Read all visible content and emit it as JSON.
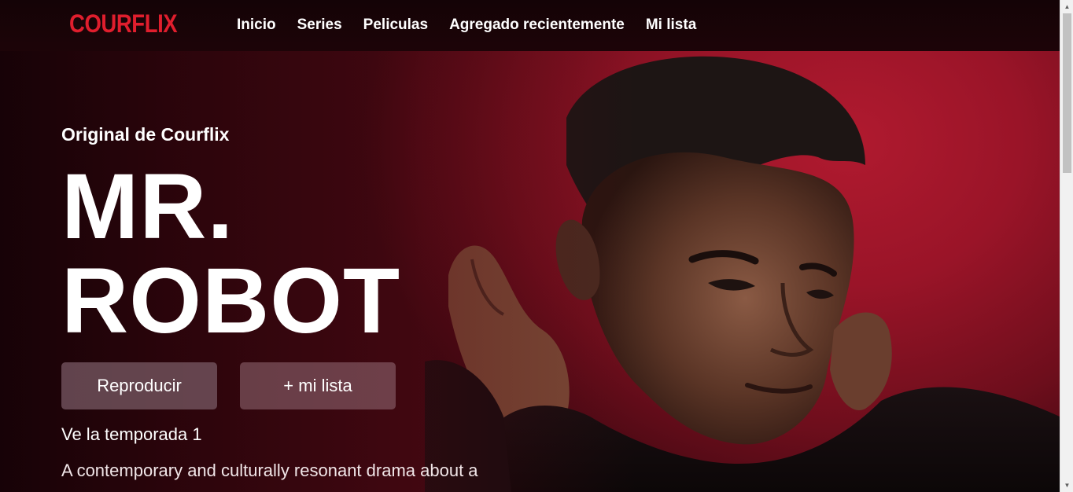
{
  "brand": {
    "logo_text": "COURFLIX",
    "logo_color": "#e01e2d"
  },
  "nav": {
    "items": [
      {
        "label": "Inicio"
      },
      {
        "label": "Series"
      },
      {
        "label": "Peliculas"
      },
      {
        "label": "Agregado recientemente"
      },
      {
        "label": "Mi lista"
      }
    ]
  },
  "hero": {
    "eyebrow": "Original de Courflix",
    "title_line1": "MR.",
    "title_line2": "ROBOT",
    "play_label": "Reproducir",
    "mylist_label": "+ mi lista",
    "season": "Ve la temporada 1",
    "synopsis": "A contemporary and culturally resonant drama about a",
    "background_color": "#9a1428"
  }
}
